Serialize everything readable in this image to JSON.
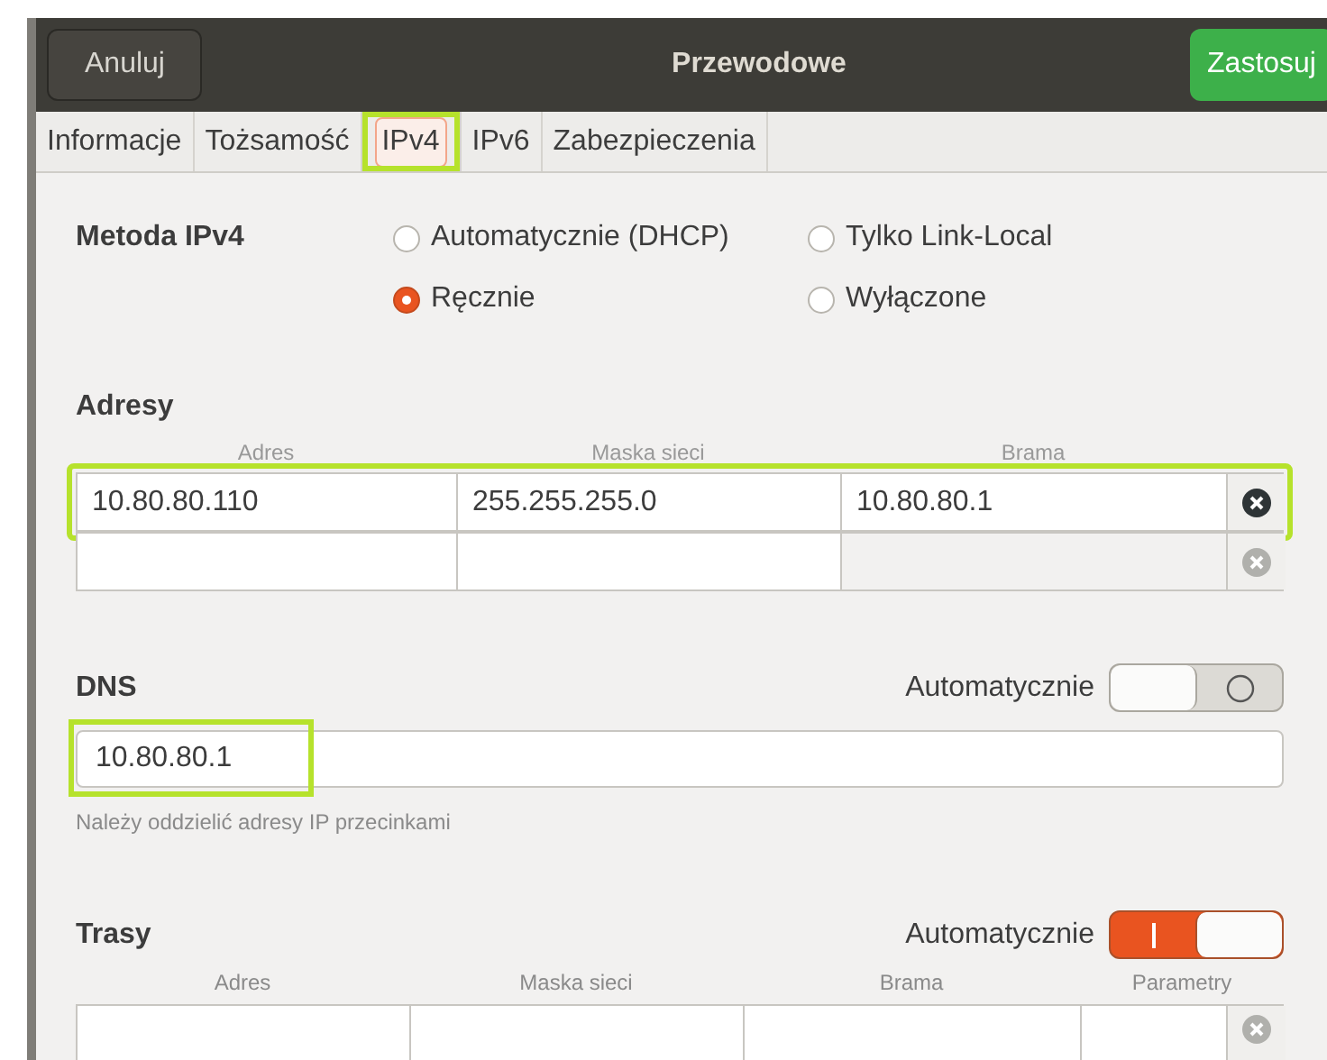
{
  "header": {
    "cancel": "Anuluj",
    "title": "Przewodowe",
    "apply": "Zastosuj"
  },
  "tabs": [
    {
      "label": "Informacje",
      "selected": false,
      "highlighted": false
    },
    {
      "label": "Tożsamość",
      "selected": false,
      "highlighted": false
    },
    {
      "label": "IPv4",
      "selected": true,
      "highlighted": true
    },
    {
      "label": "IPv6",
      "selected": false,
      "highlighted": false
    },
    {
      "label": "Zabezpieczenia",
      "selected": false,
      "highlighted": false
    }
  ],
  "method": {
    "label": "Metoda IPv4",
    "options": [
      {
        "label": "Automatycznie (DHCP)",
        "selected": false
      },
      {
        "label": "Tylko Link-Local",
        "selected": false
      },
      {
        "label": "Ręcznie",
        "selected": true
      },
      {
        "label": "Wyłączone",
        "selected": false
      }
    ]
  },
  "addresses": {
    "title": "Adresy",
    "columns": [
      "Adres",
      "Maska sieci",
      "Brama"
    ],
    "rows": [
      {
        "values": [
          "10.80.80.110",
          "255.255.255.0",
          "10.80.80.1"
        ],
        "highlighted": true
      },
      {
        "highlighted": false
      }
    ]
  },
  "dns": {
    "title": "DNS",
    "auto_label": "Automatycznie",
    "auto_on": false,
    "value": "10.80.80.1",
    "highlighted": true,
    "hint": "Należy oddzielić adresy IP przecinkami"
  },
  "routes": {
    "title": "Trasy",
    "auto_label": "Automatycznie",
    "auto_on": true,
    "columns": [
      "Adres",
      "Maska sieci",
      "Brama",
      "Parametry"
    ]
  }
}
